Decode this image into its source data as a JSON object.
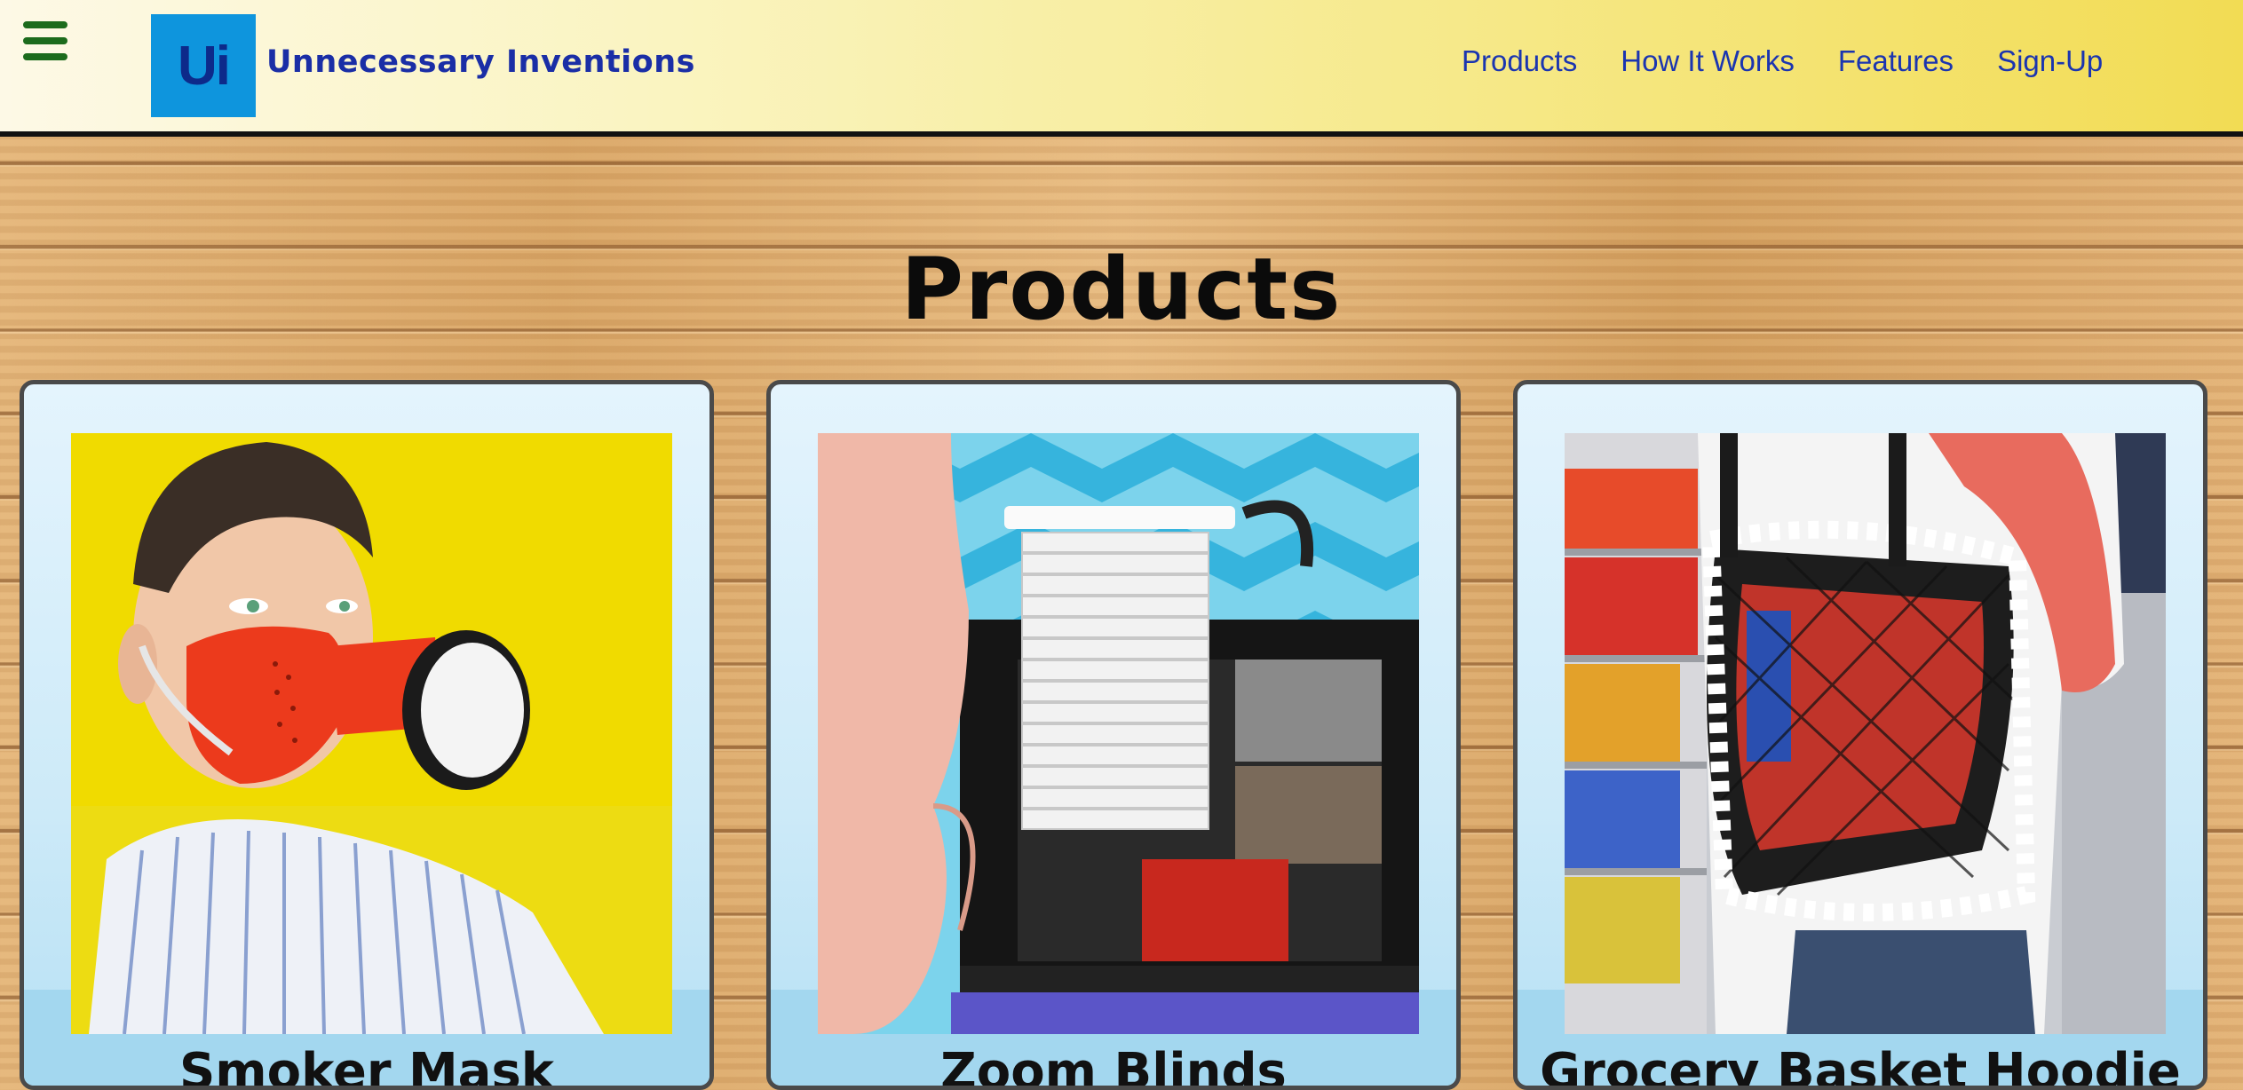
{
  "header": {
    "logo_text": "Ui",
    "brand_name": "Unnecessary Inventions",
    "nav": [
      "Products",
      "How It Works",
      "Features",
      "Sign-Up"
    ]
  },
  "main": {
    "section_title": "Products",
    "products": [
      {
        "title": "Smoker Mask",
        "image": "man-wearing-red-smoke-mask-photo"
      },
      {
        "title": "Zoom Blinds",
        "image": "mini-window-blinds-on-laptop-photo"
      },
      {
        "title": "Grocery Basket Hoodie",
        "image": "mesh-grocery-bag-hoodie-photo"
      }
    ]
  },
  "colors": {
    "brand_blue": "#1a2ea6",
    "logo_bg": "#0e95dd",
    "menu_green": "#1c6b1c",
    "header_yellow": "#f2dc54"
  }
}
